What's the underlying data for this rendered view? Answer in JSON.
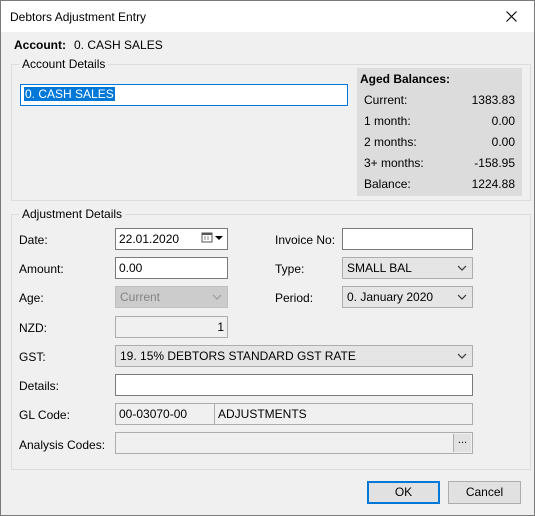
{
  "window": {
    "title": "Debtors Adjustment Entry"
  },
  "account": {
    "label": "Account:",
    "value": "0. CASH SALES"
  },
  "account_details": {
    "legend": "Account Details",
    "name_value": "0. CASH SALES"
  },
  "aged_balances": {
    "title": "Aged Balances:",
    "rows": [
      {
        "label": "Current:",
        "value": "1383.83"
      },
      {
        "label": "1 month:",
        "value": "0.00"
      },
      {
        "label": "2 months:",
        "value": "0.00"
      },
      {
        "label": "3+ months:",
        "value": "-158.95"
      },
      {
        "label": "Balance:",
        "value": "1224.88"
      }
    ]
  },
  "adjustment_details": {
    "legend": "Adjustment Details",
    "date": {
      "label": "Date:",
      "value": "22.01.2020"
    },
    "invoice_no": {
      "label": "Invoice No:",
      "value": ""
    },
    "amount": {
      "label": "Amount:",
      "value": "0.00"
    },
    "type": {
      "label": "Type:",
      "value": "SMALL BAL"
    },
    "age": {
      "label": "Age:",
      "value": "Current"
    },
    "period": {
      "label": "Period:",
      "value": "0. January 2020"
    },
    "nzd": {
      "label": "NZD:",
      "value": "1"
    },
    "gst": {
      "label": "GST:",
      "value": "19. 15% DEBTORS STANDARD GST RATE"
    },
    "details": {
      "label": "Details:",
      "value": ""
    },
    "gl_code": {
      "label": "GL Code:",
      "code": "00-03070-00",
      "name": "ADJUSTMENTS"
    },
    "analysis_codes": {
      "label": "Analysis Codes:",
      "value": "",
      "browse_label": "..."
    }
  },
  "buttons": {
    "ok": "OK",
    "cancel": "Cancel"
  },
  "colors": {
    "focus": "#0078d7",
    "panel": "#dcdcdc",
    "background": "#f0f0f0"
  },
  "icons": {
    "close": "close-icon",
    "calendar": "calendar-icon",
    "dropdown": "chevron-down-icon"
  }
}
